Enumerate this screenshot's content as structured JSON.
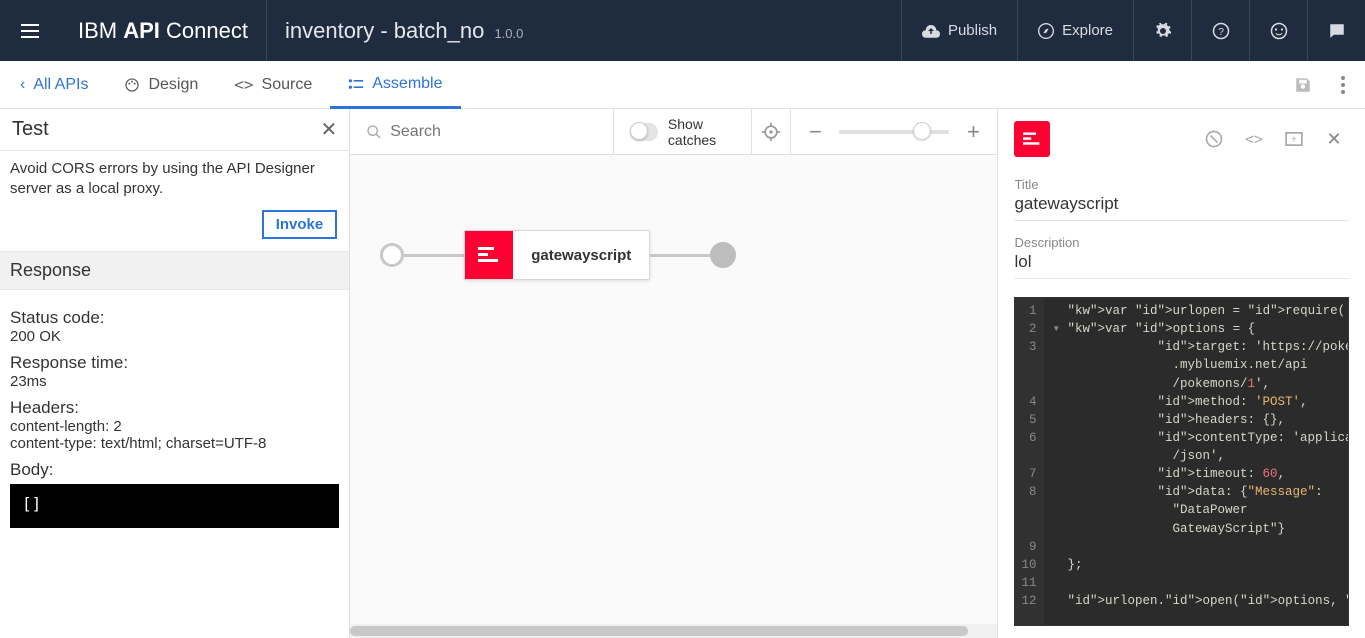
{
  "header": {
    "brand_prefix": "IBM ",
    "brand_bold": "API",
    "brand_suffix": " Connect",
    "api_name": "inventory - batch_no",
    "api_version": "1.0.0",
    "publish_label": "Publish",
    "explore_label": "Explore"
  },
  "subnav": {
    "all_apis": "All APIs",
    "design": "Design",
    "source": "Source",
    "assemble": "Assemble"
  },
  "test": {
    "title": "Test",
    "note": "Avoid CORS errors by using the API Designer server as a local proxy.",
    "invoke_label": "Invoke",
    "response_heading": "Response",
    "status_label": "Status code:",
    "status_value": "200 OK",
    "time_label": "Response time:",
    "time_value": "23ms",
    "headers_label": "Headers:",
    "headers_value1": "content-length: 2",
    "headers_value2": "content-type: text/html; charset=UTF-8",
    "body_label": "Body:",
    "body_value": "[]"
  },
  "canvas": {
    "search_placeholder": "Search",
    "show_catches_label": "Show catches",
    "node_label": "gatewayscript"
  },
  "props": {
    "title_label": "Title",
    "title_value": "gatewayscript",
    "desc_label": "Description",
    "desc_value": "lol",
    "code": {
      "lines": [
        {
          "n": "1",
          "t": "var urlopen = require('urlopen');"
        },
        {
          "n": "2",
          "t": "var options = {"
        },
        {
          "n": "3",
          "t": "            target: 'https://pokemons"
        },
        {
          "n": "",
          "t": "              .mybluemix.net/api"
        },
        {
          "n": "",
          "t": "              /pokemons/1',"
        },
        {
          "n": "4",
          "t": "            method: 'POST',"
        },
        {
          "n": "5",
          "t": "            headers: {},"
        },
        {
          "n": "6",
          "t": "            contentType: 'application"
        },
        {
          "n": "",
          "t": "              /json',"
        },
        {
          "n": "7",
          "t": "            timeout: 60,"
        },
        {
          "n": "8",
          "t": "            data: {\"Message\":"
        },
        {
          "n": "",
          "t": "              \"DataPower"
        },
        {
          "n": "",
          "t": "              GatewayScript\"}"
        },
        {
          "n": "9",
          "t": ""
        },
        {
          "n": "10",
          "t": "};"
        },
        {
          "n": "11",
          "t": ""
        },
        {
          "n": "12",
          "t": "urlopen.open(options, function(error"
        }
      ]
    }
  }
}
